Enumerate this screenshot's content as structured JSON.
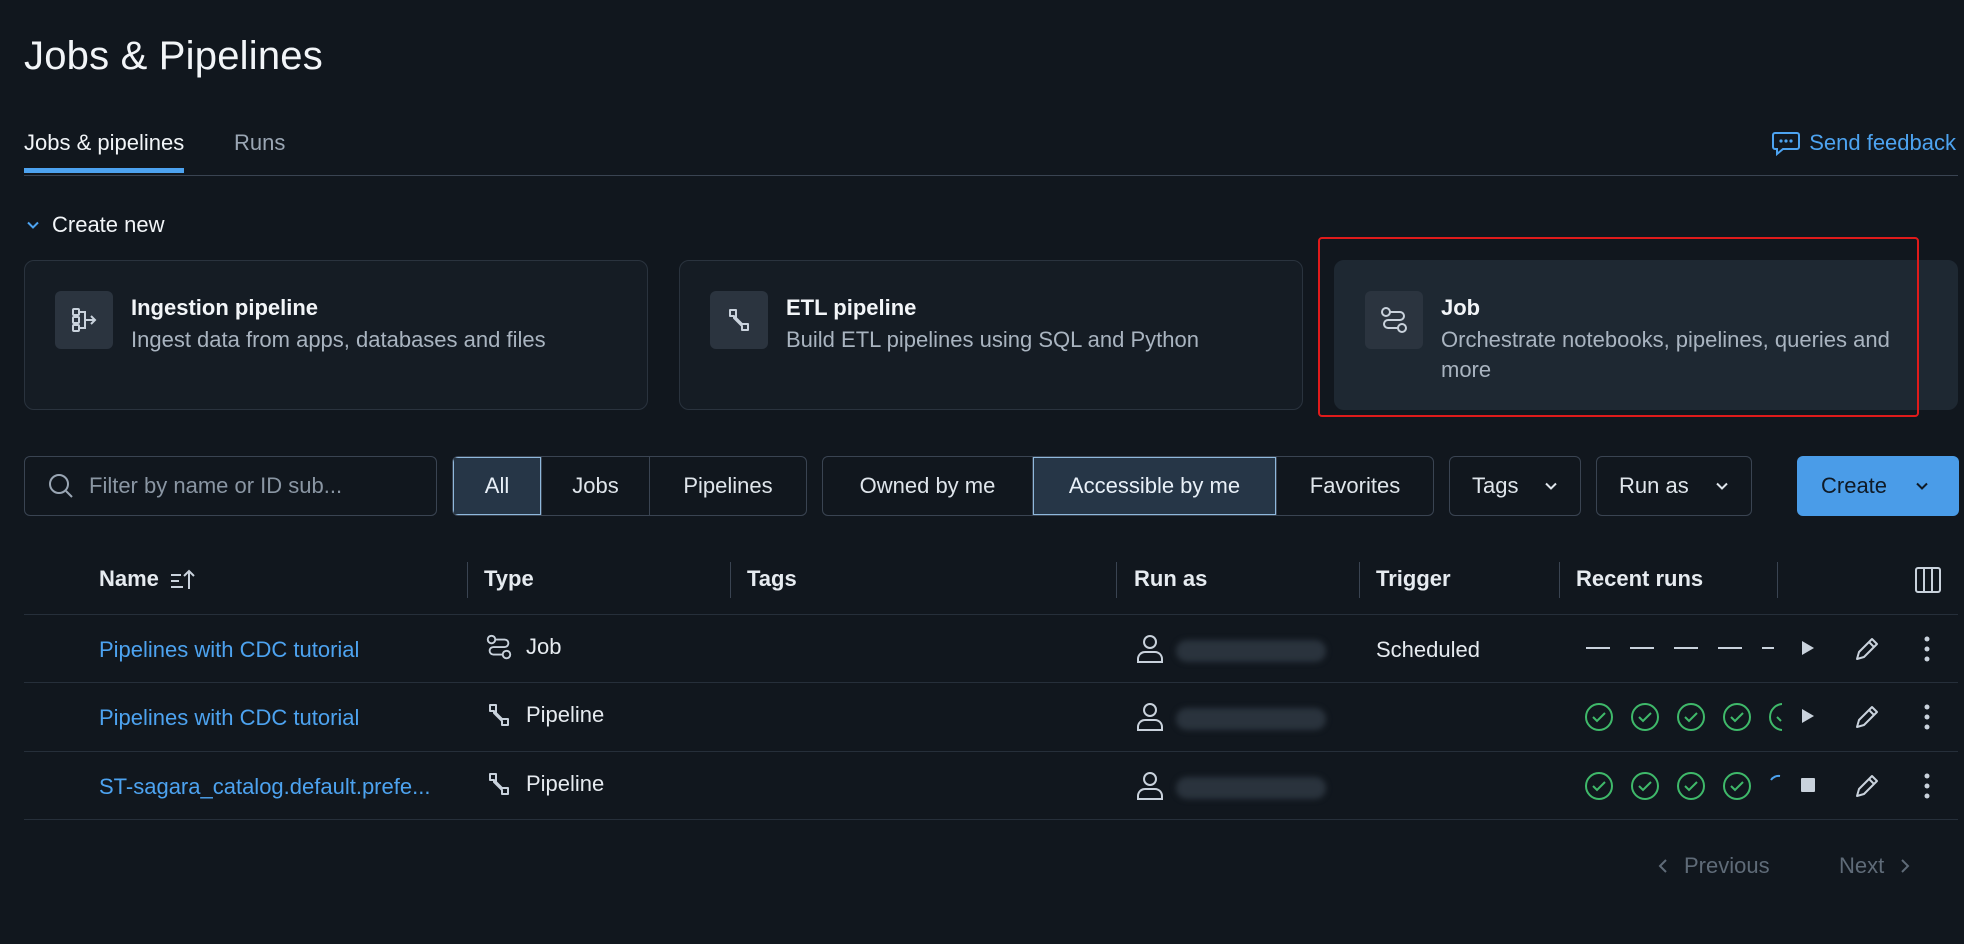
{
  "page": {
    "title": "Jobs & Pipelines"
  },
  "tabs": [
    {
      "label": "Jobs & pipelines",
      "active": true
    },
    {
      "label": "Runs",
      "active": false
    }
  ],
  "feedback": {
    "label": "Send feedback"
  },
  "create_new": {
    "label": "Create new",
    "cards": [
      {
        "title": "Ingestion pipeline",
        "desc": "Ingest data from apps, databases and files",
        "icon": "ingestion-icon"
      },
      {
        "title": "ETL pipeline",
        "desc": "Build ETL pipelines using SQL and Python",
        "icon": "etl-icon"
      },
      {
        "title": "Job",
        "desc": "Orchestrate notebooks, pipelines, queries and more",
        "icon": "job-icon",
        "selected": true
      }
    ]
  },
  "filters": {
    "search_placeholder": "Filter by name or ID sub...",
    "type_options": [
      "All",
      "Jobs",
      "Pipelines"
    ],
    "type_selected": "All",
    "owner_options": [
      "Owned by me",
      "Accessible by me",
      "Favorites"
    ],
    "owner_selected": "Accessible by me",
    "tags_label": "Tags",
    "runas_label": "Run as",
    "create_label": "Create"
  },
  "table": {
    "headers": {
      "name": "Name",
      "type": "Type",
      "tags": "Tags",
      "run_as": "Run as",
      "trigger": "Trigger",
      "recent_runs": "Recent runs"
    },
    "rows": [
      {
        "name": "Pipelines with CDC tutorial",
        "type": "Job",
        "trigger": "Scheduled",
        "runs": "none"
      },
      {
        "name": "Pipelines with CDC tutorial",
        "type": "Pipeline",
        "trigger": "",
        "runs": "success"
      },
      {
        "name": "ST-sagara_catalog.default.prefe...",
        "type": "Pipeline",
        "trigger": "",
        "runs": "running"
      }
    ]
  },
  "pagination": {
    "previous": "Previous",
    "next": "Next"
  },
  "colors": {
    "accent": "#4da3f0",
    "success": "#3fb96a",
    "selection": "#e01b1b"
  }
}
